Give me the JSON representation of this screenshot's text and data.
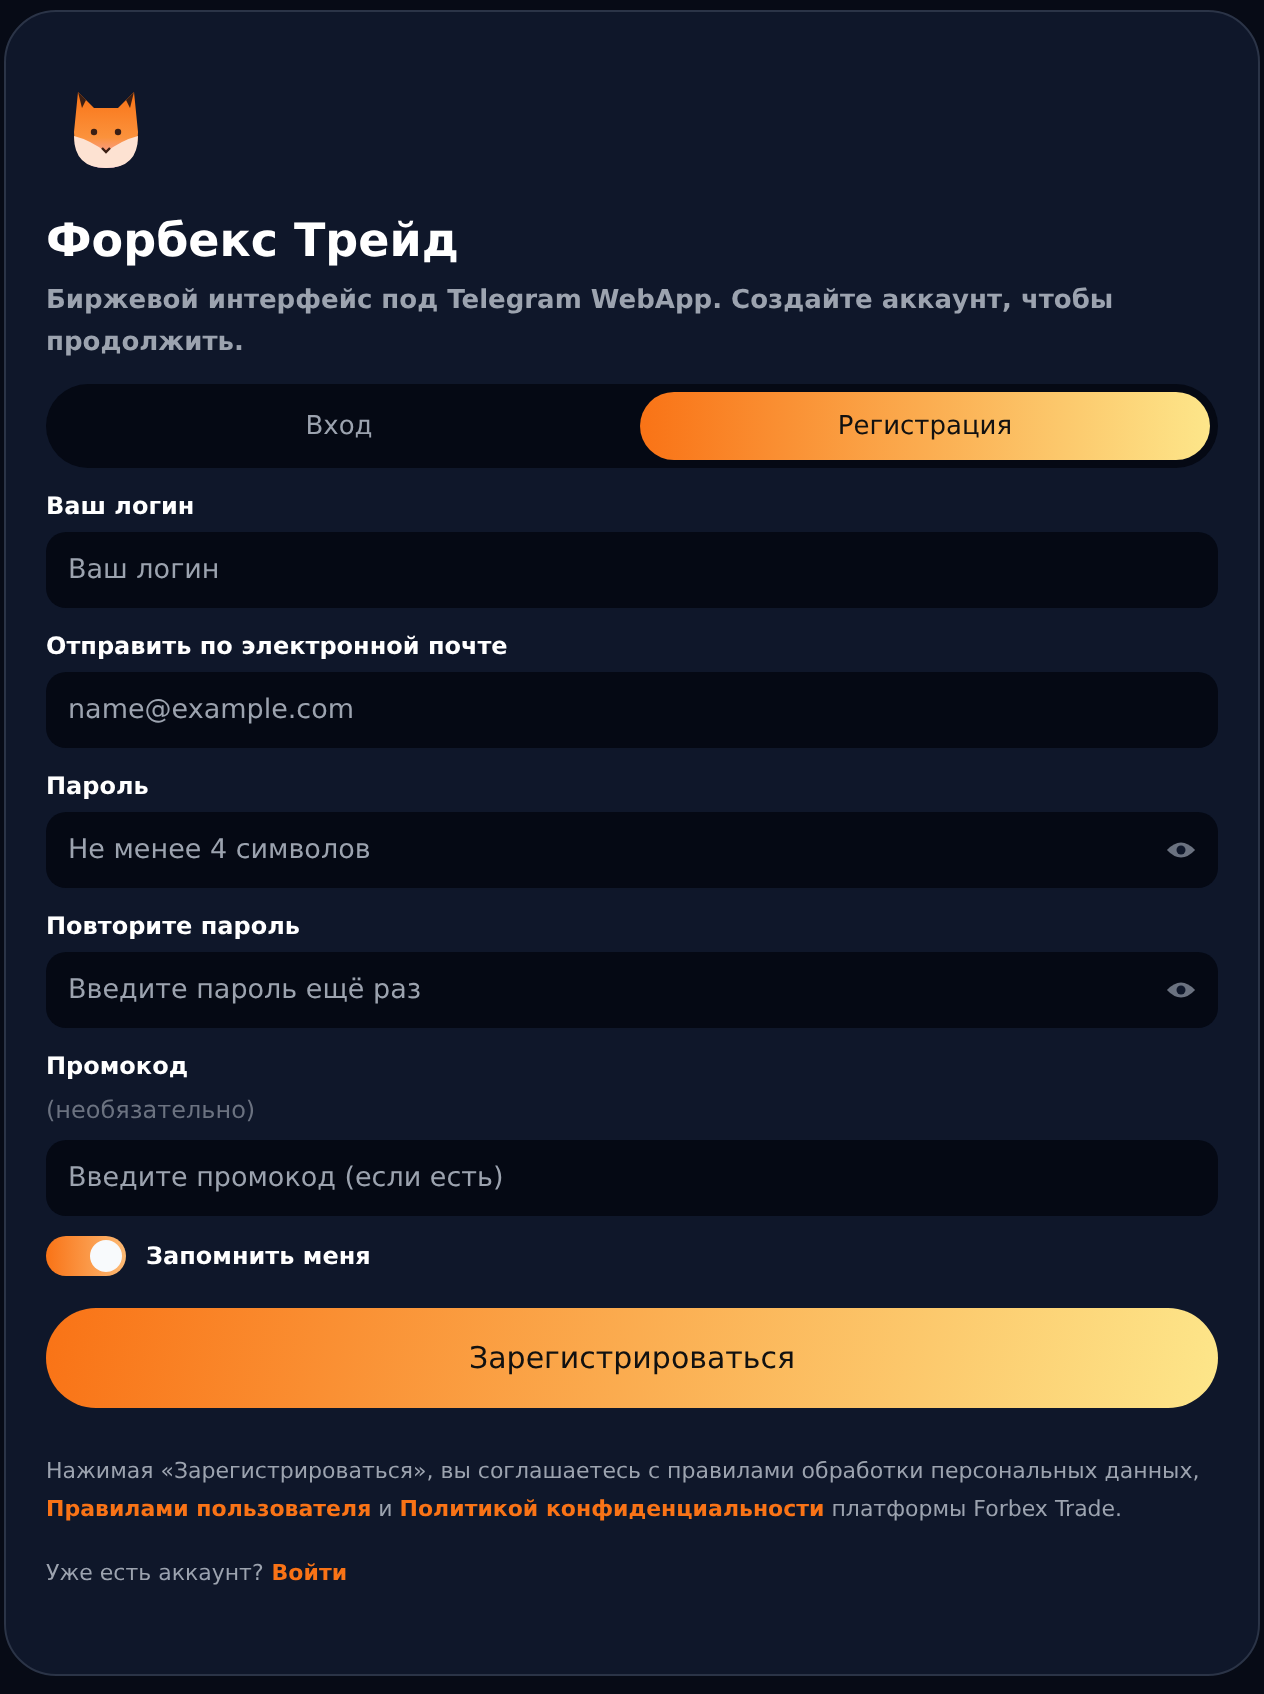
{
  "brand": {
    "title": "Форбекс Трейд",
    "subtitle": "Биржевой интерфейс под Telegram WebApp. Создайте аккаунт, чтобы продолжить."
  },
  "tabs": [
    {
      "label": "Вход",
      "selected": false
    },
    {
      "label": "Регистрация",
      "selected": true
    }
  ],
  "fields": [
    {
      "label": "Ваш логин",
      "placeholder": "Ваш логин",
      "password_toggle": false
    },
    {
      "label": "Отправить по электронной почте",
      "placeholder": "name@example.com",
      "password_toggle": false
    },
    {
      "label": "Пароль",
      "placeholder": "Не менее 4 символов",
      "password_toggle": true
    },
    {
      "label": "Повторите пароль",
      "placeholder": "Введите пароль ещё раз",
      "password_toggle": true
    },
    {
      "label": "Промокод",
      "hint": "(необязательно)",
      "placeholder": "Введите промокод (если есть)",
      "password_toggle": false
    }
  ],
  "remember": {
    "label": "Запомнить меня",
    "on": true
  },
  "submit": "Зарегистрироваться",
  "legal": [
    {
      "kind": "text",
      "text": "Нажимая «Зарегистрироваться», вы соглашаетесь с правилами обработки персональных данных,"
    },
    {
      "kind": "link",
      "text": "Правилами пользователя"
    },
    {
      "kind": "text",
      "text": "и"
    },
    {
      "kind": "link",
      "text": "Политикой конфиденциальности"
    },
    {
      "kind": "text",
      "text": "платформы Forbex Trade."
    }
  ],
  "footer": {
    "text": "Уже есть аккаунт?",
    "link": "Войти"
  }
}
